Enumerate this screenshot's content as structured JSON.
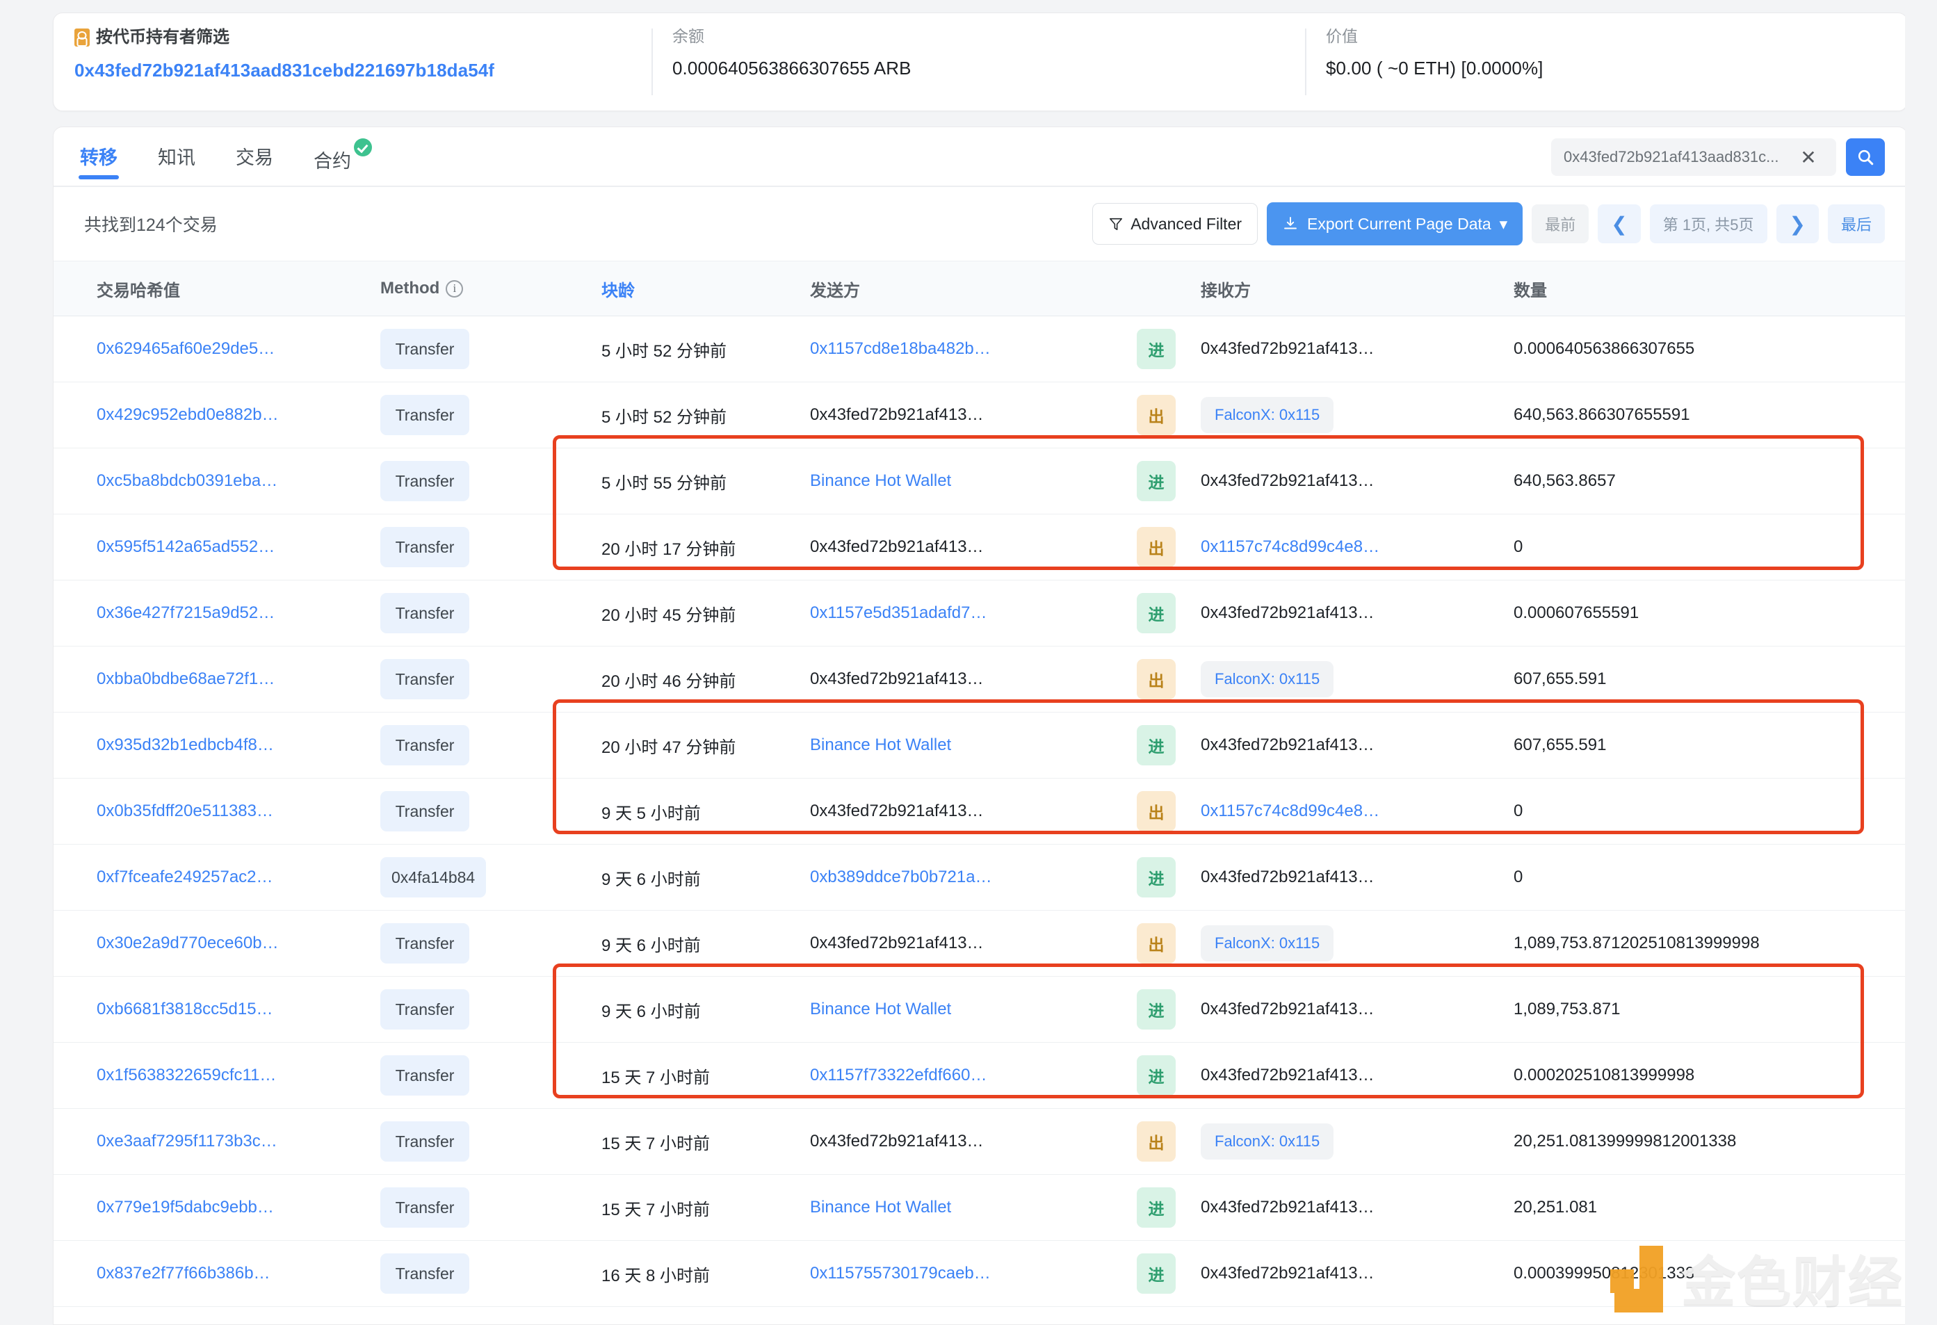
{
  "summary": {
    "holder_filter_label": "按代币持有者筛选",
    "holder_address": "0x43fed72b921af413aad831cebd221697b18da54f",
    "balance_label": "余额",
    "balance_value": "0.000640563866307655 ARB",
    "value_label": "价值",
    "value_value": "$0.00 ( ~0 ETH) [0.0000%]"
  },
  "tabs": [
    {
      "label": "转移",
      "active": true
    },
    {
      "label": "知讯",
      "active": false
    },
    {
      "label": "交易",
      "active": false
    },
    {
      "label": "合约",
      "active": false,
      "verified": true
    }
  ],
  "search": {
    "value": "0x43fed72b921af413aad831c...",
    "clear_label": "✕",
    "icon": "search-icon"
  },
  "toolbar": {
    "found_text": "共找到124个交易",
    "advanced_filter_label": "Advanced Filter",
    "export_label": "Export Current Page Data",
    "export_caret": "▾",
    "pagination": {
      "first": "最前",
      "prev": "❮",
      "info": "第 1页, 共5页",
      "next": "❯",
      "last": "最后"
    }
  },
  "table": {
    "columns": [
      {
        "key": "hash",
        "label": "交易哈希值",
        "sortable": false
      },
      {
        "key": "method",
        "label": "Method",
        "info": true,
        "sortable": false
      },
      {
        "key": "age",
        "label": "块龄",
        "sortable": true
      },
      {
        "key": "from",
        "label": "发送方",
        "sortable": false
      },
      {
        "key": "dir",
        "label": "",
        "sortable": false
      },
      {
        "key": "to",
        "label": "接收方",
        "sortable": false
      },
      {
        "key": "amount",
        "label": "数量",
        "sortable": false
      }
    ],
    "rows": [
      {
        "hash": "0x629465af60e29de5…",
        "hash_link": true,
        "method": "Transfer",
        "age": "5 小时 52 分钟前",
        "from": "0x1157cd8e18ba482b…",
        "from_link": true,
        "from_tag": false,
        "dir": "进",
        "to": "0x43fed72b921af413…",
        "to_link": false,
        "to_tag": false,
        "amount": "0.000640563866307655"
      },
      {
        "hash": "0x429c952ebd0e882b…",
        "hash_link": true,
        "method": "Transfer",
        "age": "5 小时 52 分钟前",
        "from": "0x43fed72b921af413…",
        "from_link": false,
        "from_tag": false,
        "dir": "出",
        "to": "FalconX: 0x115",
        "to_link": true,
        "to_tag": true,
        "amount": "640,563.866307655591"
      },
      {
        "hash": "0xc5ba8bdcb0391eba…",
        "hash_link": true,
        "method": "Transfer",
        "age": "5 小时 55 分钟前",
        "from": "Binance Hot Wallet",
        "from_link": true,
        "from_tag": false,
        "dir": "进",
        "to": "0x43fed72b921af413…",
        "to_link": false,
        "to_tag": false,
        "amount": "640,563.8657"
      },
      {
        "hash": "0x595f5142a65ad552…",
        "hash_link": true,
        "method": "Transfer",
        "age": "20 小时 17 分钟前",
        "from": "0x43fed72b921af413…",
        "from_link": false,
        "from_tag": false,
        "dir": "出",
        "to": "0x1157c74c8d99c4e8…",
        "to_link": true,
        "to_tag": false,
        "amount": "0"
      },
      {
        "hash": "0x36e427f7215a9d52…",
        "hash_link": true,
        "method": "Transfer",
        "age": "20 小时 45 分钟前",
        "from": "0x1157e5d351adafd7…",
        "from_link": true,
        "from_tag": false,
        "dir": "进",
        "to": "0x43fed72b921af413…",
        "to_link": false,
        "to_tag": false,
        "amount": "0.000607655591"
      },
      {
        "hash": "0xbba0bdbe68ae72f1…",
        "hash_link": true,
        "method": "Transfer",
        "age": "20 小时 46 分钟前",
        "from": "0x43fed72b921af413…",
        "from_link": false,
        "from_tag": false,
        "dir": "出",
        "to": "FalconX: 0x115",
        "to_link": true,
        "to_tag": true,
        "amount": "607,655.591"
      },
      {
        "hash": "0x935d32b1edbcb4f8…",
        "hash_link": true,
        "method": "Transfer",
        "age": "20 小时 47 分钟前",
        "from": "Binance Hot Wallet",
        "from_link": true,
        "from_tag": false,
        "dir": "进",
        "to": "0x43fed72b921af413…",
        "to_link": false,
        "to_tag": false,
        "amount": "607,655.591"
      },
      {
        "hash": "0x0b35fdff20e511383…",
        "hash_link": true,
        "method": "Transfer",
        "age": "9 天 5 小时前",
        "from": "0x43fed72b921af413…",
        "from_link": false,
        "from_tag": false,
        "dir": "出",
        "to": "0x1157c74c8d99c4e8…",
        "to_link": true,
        "to_tag": false,
        "amount": "0"
      },
      {
        "hash": "0xf7fceafe249257ac2…",
        "hash_link": true,
        "method": "0x4fa14b84",
        "age": "9 天 6 小时前",
        "from": "0xb389ddce7b0b721a…",
        "from_link": true,
        "from_tag": false,
        "dir": "进",
        "to": "0x43fed72b921af413…",
        "to_link": false,
        "to_tag": false,
        "amount": "0"
      },
      {
        "hash": "0x30e2a9d770ece60b…",
        "hash_link": true,
        "method": "Transfer",
        "age": "9 天 6 小时前",
        "from": "0x43fed72b921af413…",
        "from_link": false,
        "from_tag": false,
        "dir": "出",
        "to": "FalconX: 0x115",
        "to_link": true,
        "to_tag": true,
        "amount": "1,089,753.871202510813999998"
      },
      {
        "hash": "0xb6681f3818cc5d15…",
        "hash_link": true,
        "method": "Transfer",
        "age": "9 天 6 小时前",
        "from": "Binance Hot Wallet",
        "from_link": true,
        "from_tag": false,
        "dir": "进",
        "to": "0x43fed72b921af413…",
        "to_link": false,
        "to_tag": false,
        "amount": "1,089,753.871"
      },
      {
        "hash": "0x1f5638322659cfc11…",
        "hash_link": true,
        "method": "Transfer",
        "age": "15 天 7 小时前",
        "from": "0x1157f73322efdf660…",
        "from_link": true,
        "from_tag": false,
        "dir": "进",
        "to": "0x43fed72b921af413…",
        "to_link": false,
        "to_tag": false,
        "amount": "0.000202510813999998"
      },
      {
        "hash": "0xe3aaf7295f1173b3c…",
        "hash_link": true,
        "method": "Transfer",
        "age": "15 天 7 小时前",
        "from": "0x43fed72b921af413…",
        "from_link": false,
        "from_tag": false,
        "dir": "出",
        "to": "FalconX: 0x115",
        "to_link": true,
        "to_tag": true,
        "amount": "20,251.081399999812001338"
      },
      {
        "hash": "0x779e19f5dabc9ebb…",
        "hash_link": true,
        "method": "Transfer",
        "age": "15 天 7 小时前",
        "from": "Binance Hot Wallet",
        "from_link": true,
        "from_tag": false,
        "dir": "进",
        "to": "0x43fed72b921af413…",
        "to_link": false,
        "to_tag": false,
        "amount": "20,251.081"
      },
      {
        "hash": "0x837e2f77f66b386b…",
        "hash_link": true,
        "method": "Transfer",
        "age": "16 天 8 小时前",
        "from": "0x115755730179caeb…",
        "from_link": true,
        "from_tag": false,
        "dir": "进",
        "to": "0x43fed72b921af413…",
        "to_link": false,
        "to_tag": false,
        "amount": "0.000399950812301338"
      }
    ],
    "highlight_row_groups": [
      [
        1,
        2
      ],
      [
        5,
        6
      ],
      [
        9,
        10
      ]
    ],
    "highlight_color": "#e8401f"
  },
  "watermark": {
    "text": "金色财经"
  }
}
